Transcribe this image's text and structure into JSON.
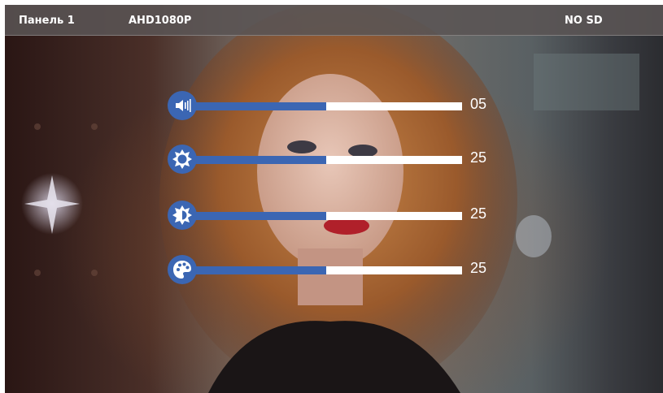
{
  "header": {
    "channel": "Панель 1",
    "resolution": "AHD1080P",
    "storage": "NO SD"
  },
  "sliders": [
    {
      "id": "volume",
      "icon": "speaker-volume-icon",
      "value_label": "05",
      "fill_fraction": 0.5
    },
    {
      "id": "brightness",
      "icon": "sun-brightness-icon",
      "value_label": "25",
      "fill_fraction": 0.5
    },
    {
      "id": "contrast",
      "icon": "half-sun-contrast-icon",
      "value_label": "25",
      "fill_fraction": 0.5
    },
    {
      "id": "color",
      "icon": "palette-color-icon",
      "value_label": "25",
      "fill_fraction": 0.5
    }
  ],
  "colors": {
    "accent": "#3b66b3",
    "track": "#ffffff",
    "topbar": "#5a5454"
  }
}
